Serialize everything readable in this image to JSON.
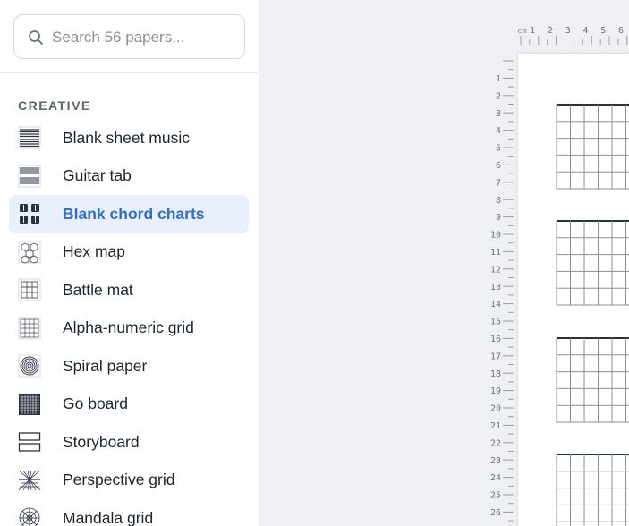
{
  "search": {
    "placeholder": "Search 56 papers..."
  },
  "section": {
    "title": "CREATIVE"
  },
  "items": [
    {
      "label": "Blank sheet music",
      "icon": "sheet-music-icon",
      "active": false
    },
    {
      "label": "Guitar tab",
      "icon": "guitar-tab-icon",
      "active": false
    },
    {
      "label": "Blank chord charts",
      "icon": "chord-charts-icon",
      "active": true
    },
    {
      "label": "Hex map",
      "icon": "hex-map-icon",
      "active": false
    },
    {
      "label": "Battle mat",
      "icon": "battle-mat-icon",
      "active": false
    },
    {
      "label": "Alpha-numeric grid",
      "icon": "alpha-numeric-grid-icon",
      "active": false
    },
    {
      "label": "Spiral paper",
      "icon": "spiral-icon",
      "active": false
    },
    {
      "label": "Go board",
      "icon": "go-board-icon",
      "active": false
    },
    {
      "label": "Storyboard",
      "icon": "storyboard-icon",
      "active": false
    },
    {
      "label": "Perspective grid",
      "icon": "perspective-grid-icon",
      "active": false
    },
    {
      "label": "Mandala grid",
      "icon": "mandala-icon",
      "active": false
    }
  ],
  "ruler": {
    "unit": "cm",
    "h_labels": [
      "1",
      "2",
      "3",
      "4",
      "5",
      "6"
    ],
    "v_labels": [
      "1",
      "2",
      "3",
      "4",
      "5",
      "6",
      "7",
      "8",
      "9",
      "10",
      "11",
      "12",
      "13",
      "14",
      "15",
      "16",
      "17",
      "18",
      "19",
      "20",
      "21",
      "22",
      "23",
      "24",
      "25",
      "26"
    ]
  },
  "colors": {
    "accent": "#2f6fd0",
    "active_bg": "#e9f0fc",
    "icon_dark": "#2a3140"
  }
}
